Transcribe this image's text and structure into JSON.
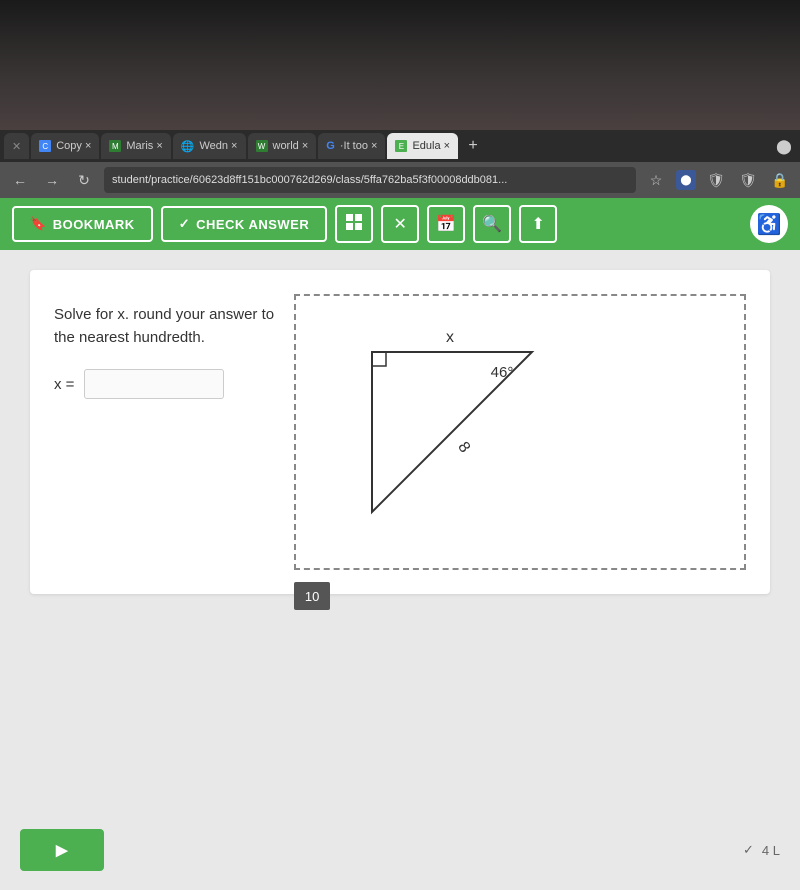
{
  "top_dark": {
    "height": 130
  },
  "browser": {
    "tabs": [
      {
        "id": "tab1",
        "label": "×",
        "icon": "📄",
        "active": false,
        "short": "×"
      },
      {
        "id": "tab2",
        "label": "Copy ×",
        "icon": "📄",
        "active": false
      },
      {
        "id": "tab3",
        "label": "Maris ×",
        "icon": "📋",
        "active": false
      },
      {
        "id": "tab4",
        "label": "Wedn ×",
        "icon": "🌐",
        "active": false
      },
      {
        "id": "tab5",
        "label": "world ×",
        "icon": "📋",
        "active": false
      },
      {
        "id": "tab6",
        "label": "·It too ×",
        "icon": "G",
        "active": false
      },
      {
        "id": "tab7",
        "label": "Edula ×",
        "icon": "E",
        "active": true
      }
    ],
    "address": "student/practice/60623d8ff151bc000762d269/class/5ffa762ba5f3f00008ddb081...",
    "add_tab": "+"
  },
  "toolbar": {
    "bookmark_label": "BOOKMARK",
    "check_answer_label": "CHECK ANSWER",
    "grid_icon": "⊞",
    "close_icon": "✕",
    "calendar_icon": "📅",
    "search_icon": "🔍",
    "upload_icon": "⬆",
    "accessibility_icon": "♿"
  },
  "question": {
    "text_line1": "Solve for x. round your answer to",
    "text_line2": "the nearest hundredth.",
    "label": "x =",
    "input_placeholder": "",
    "input_value": "",
    "diagram": {
      "angle_label": "46°",
      "x_label": "x",
      "hyp_label": "8",
      "right_angle": true
    }
  },
  "page": {
    "number": "10",
    "bottom_btn_label": ""
  }
}
